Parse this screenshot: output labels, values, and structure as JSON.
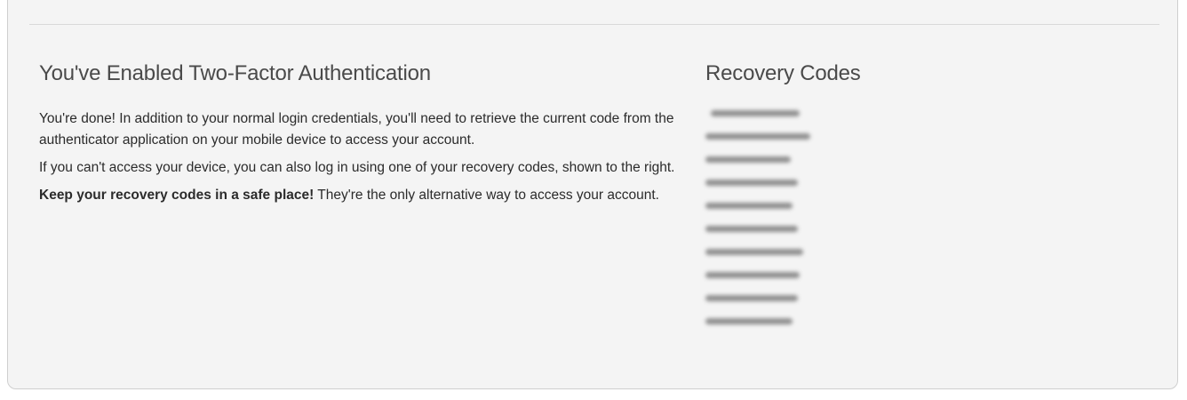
{
  "section": {
    "title": "You've Enabled Two-Factor Authentication",
    "paragraphs": {
      "p1": "You're done! In addition to your normal login credentials, you'll need to retrieve the current code from the authenticator application on your mobile device to access your account.",
      "p2": "If you can't access your device, you can also log in using one of your recovery codes, shown to the right.",
      "p3_bold": "Keep your recovery codes in a safe place!",
      "p3_rest": " They're the only alternative way to access your account."
    }
  },
  "recovery": {
    "title": "Recovery Codes",
    "codes_redacted_count": 10
  }
}
